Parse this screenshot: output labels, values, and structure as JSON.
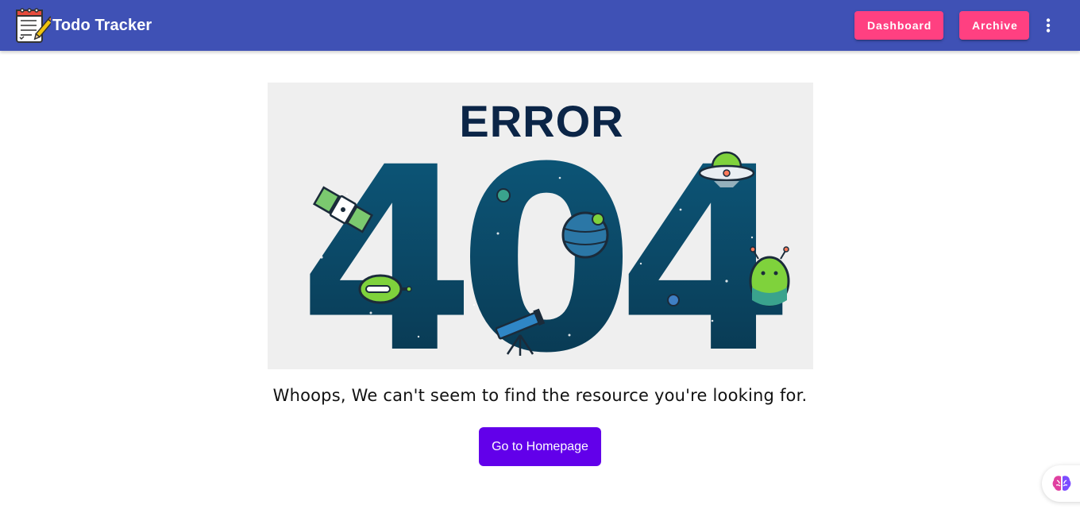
{
  "header": {
    "title": "Todo Tracker",
    "logo_icon": "notepad-pencil-icon",
    "nav": {
      "dashboard_label": "Dashboard",
      "archive_label": "Archive",
      "more_icon": "more-vert-icon"
    },
    "colors": {
      "bar": "#3f51b5",
      "nav_button": "#ff4081"
    }
  },
  "illustration": {
    "heading": "ERROR",
    "code": "404"
  },
  "main": {
    "message": "Whoops, We can't seem to find the resource you're looking for.",
    "home_button_label": "Go to Homepage",
    "colors": {
      "home_button": "#6200ea"
    }
  },
  "widget": {
    "icon": "brain-icon"
  }
}
